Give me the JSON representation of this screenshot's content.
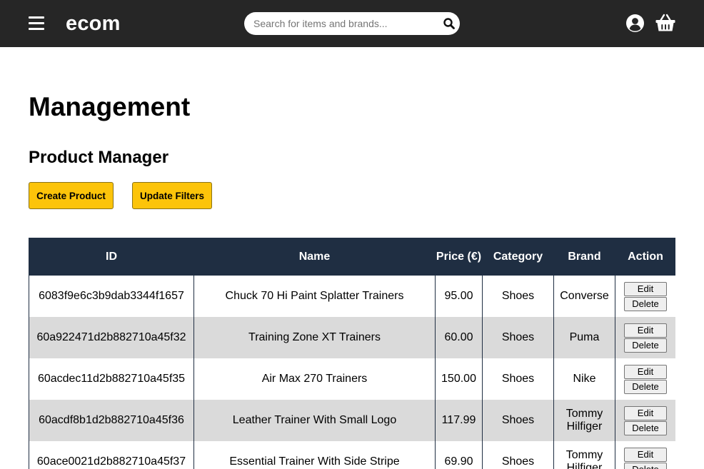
{
  "navbar": {
    "logo": "ecom",
    "search_placeholder": "Search for items and brands..."
  },
  "page": {
    "title": "Management",
    "section_title": "Product Manager",
    "create_button": "Create Product",
    "filters_button": "Update Filters"
  },
  "table": {
    "headers": [
      "ID",
      "Name",
      "Price (€)",
      "Category",
      "Brand",
      "Action"
    ],
    "edit_label": "Edit",
    "delete_label": "Delete",
    "rows": [
      {
        "id": "6083f9e6c3b9dab3344f1657",
        "name": "Chuck 70 Hi Paint Splatter Trainers",
        "price": "95.00",
        "category": "Shoes",
        "brand": "Converse"
      },
      {
        "id": "60a922471d2b882710a45f32",
        "name": "Training Zone XT Trainers",
        "price": "60.00",
        "category": "Shoes",
        "brand": "Puma"
      },
      {
        "id": "60acdec11d2b882710a45f35",
        "name": "Air Max 270 Trainers",
        "price": "150.00",
        "category": "Shoes",
        "brand": "Nike"
      },
      {
        "id": "60acdf8b1d2b882710a45f36",
        "name": "Leather Trainer With Small Logo",
        "price": "117.99",
        "category": "Shoes",
        "brand": "Tommy Hilfiger"
      },
      {
        "id": "60ace0021d2b882710a45f37",
        "name": "Essential Trainer With Side Stripe",
        "price": "69.90",
        "category": "Shoes",
        "brand": "Tommy Hilfiger"
      }
    ]
  },
  "icons": {
    "menu": "hamburger-menu-icon",
    "search": "search-icon",
    "account": "user-circle-icon",
    "cart": "basket-icon"
  },
  "colors": {
    "navbar": "#262626",
    "accent_yellow": "#fcc40a",
    "table_header": "#1f2e42",
    "row_alt": "#dadada"
  }
}
